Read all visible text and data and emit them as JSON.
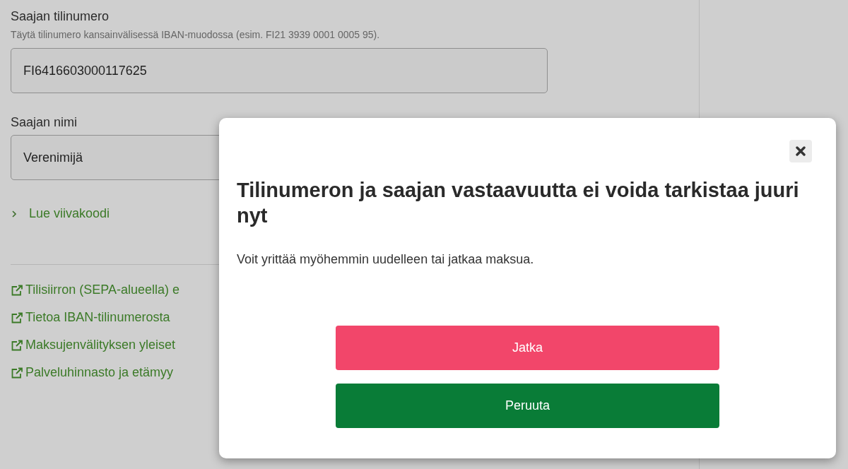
{
  "form": {
    "account": {
      "label": "Saajan tilinumero",
      "hint": "Täytä tilinumero kansainvälisessä IBAN-muodossa (esim. FI21 3939 0001 0005 95).",
      "value": "FI6416603000117625"
    },
    "name": {
      "label": "Saajan nimi",
      "value": "Verenimijä"
    },
    "barcode": {
      "label": "Lue viivakoodi",
      "expanded": false
    },
    "links": [
      "Tilisiirron (SEPA-alueella) e",
      "Tietoa IBAN-tilinumerosta",
      "Maksujenvälityksen yleiset",
      "Palveluhinnasto ja etämyy"
    ]
  },
  "dialog": {
    "title": "Tilinumeron ja saajan vastaavuutta ei voida tarkistaa juuri nyt",
    "message": "Voit yrittää myöhemmin uudelleen tai jatkaa maksua.",
    "buttons": [
      {
        "label": "Jatka",
        "kind": "danger"
      },
      {
        "label": "Peruuta",
        "kind": "success"
      }
    ]
  }
}
